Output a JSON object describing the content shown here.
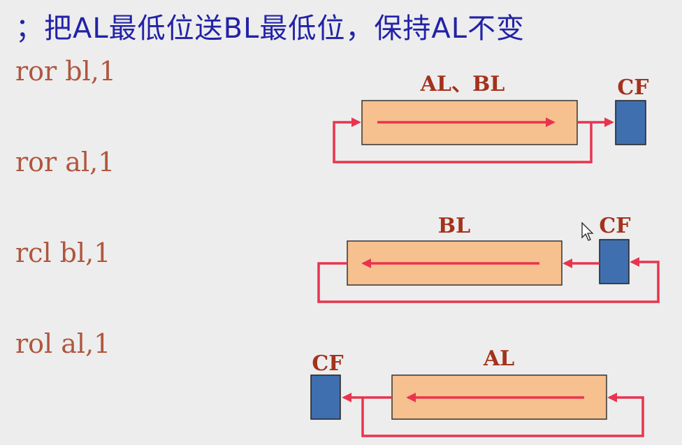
{
  "title": "；把AL最低位送BL最低位，保持AL不变",
  "code": [
    "ror bl,1",
    "ror al,1",
    "rcl bl,1",
    "rol al,1"
  ],
  "diagrams": [
    {
      "register_label": "AL、BL",
      "flag_label": "CF"
    },
    {
      "register_label": "BL",
      "flag_label": "CF"
    },
    {
      "register_label": "AL",
      "flag_label": "CF"
    }
  ],
  "colors": {
    "register_fill": "#f6c08f",
    "flag_fill": "#3f6fae",
    "arrow": "#e8344e",
    "title_text": "#2222a8",
    "code_text": "#b0563e",
    "label_text": "#a4321c"
  }
}
